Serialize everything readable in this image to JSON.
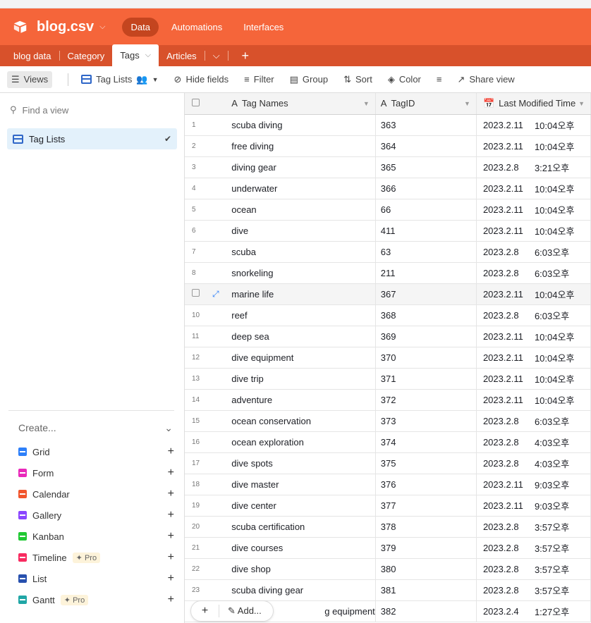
{
  "app": {
    "base_name": "blog.csv",
    "nav": [
      "Data",
      "Automations",
      "Interfaces"
    ]
  },
  "tables": [
    "blog data",
    "Category",
    "Tags",
    "Articles"
  ],
  "toolbar": {
    "views": "Views",
    "current_view": "Tag Lists",
    "hide_fields": "Hide fields",
    "filter": "Filter",
    "group": "Group",
    "sort": "Sort",
    "color": "Color",
    "share_view": "Share view"
  },
  "sidebar": {
    "find_placeholder": "Find a view",
    "views": [
      {
        "label": "Tag Lists"
      }
    ],
    "create_label": "Create...",
    "create_items": [
      {
        "label": "Grid",
        "color": "#2d7ff9"
      },
      {
        "label": "Form",
        "color": "#e929ba"
      },
      {
        "label": "Calendar",
        "color": "#f2552c"
      },
      {
        "label": "Gallery",
        "color": "#8b46ff"
      },
      {
        "label": "Kanban",
        "color": "#20c933"
      },
      {
        "label": "Timeline",
        "color": "#f82b60",
        "badge": "Pro"
      },
      {
        "label": "List",
        "color": "#2750ae"
      },
      {
        "label": "Gantt",
        "color": "#20a6a6",
        "badge": "Pro"
      }
    ]
  },
  "columns": [
    "Tag Names",
    "TagID",
    "Last Modified Time"
  ],
  "rows": [
    {
      "n": "1",
      "name": "scuba diving",
      "id": "363",
      "date": "2023.2.11",
      "time": "10:04오후"
    },
    {
      "n": "2",
      "name": "free diving",
      "id": "364",
      "date": "2023.2.11",
      "time": "10:04오후"
    },
    {
      "n": "3",
      "name": "diving gear",
      "id": "365",
      "date": "2023.2.8",
      "time": "3:21오후"
    },
    {
      "n": "4",
      "name": "underwater",
      "id": "366",
      "date": "2023.2.11",
      "time": "10:04오후"
    },
    {
      "n": "5",
      "name": "ocean",
      "id": "66",
      "date": "2023.2.11",
      "time": "10:04오후"
    },
    {
      "n": "6",
      "name": "dive",
      "id": "411",
      "date": "2023.2.11",
      "time": "10:04오후"
    },
    {
      "n": "7",
      "name": "scuba",
      "id": "63",
      "date": "2023.2.8",
      "time": "6:03오후"
    },
    {
      "n": "8",
      "name": "snorkeling",
      "id": "211",
      "date": "2023.2.8",
      "time": "6:03오후"
    },
    {
      "n": "",
      "name": "marine life",
      "id": "367",
      "date": "2023.2.11",
      "time": "10:04오후",
      "hover": true
    },
    {
      "n": "10",
      "name": "reef",
      "id": "368",
      "date": "2023.2.8",
      "time": "6:03오후"
    },
    {
      "n": "11",
      "name": "deep sea",
      "id": "369",
      "date": "2023.2.11",
      "time": "10:04오후"
    },
    {
      "n": "12",
      "name": "dive equipment",
      "id": "370",
      "date": "2023.2.11",
      "time": "10:04오후"
    },
    {
      "n": "13",
      "name": "dive trip",
      "id": "371",
      "date": "2023.2.11",
      "time": "10:04오후"
    },
    {
      "n": "14",
      "name": "adventure",
      "id": "372",
      "date": "2023.2.11",
      "time": "10:04오후"
    },
    {
      "n": "15",
      "name": "ocean conservation",
      "id": "373",
      "date": "2023.2.8",
      "time": "6:03오후"
    },
    {
      "n": "16",
      "name": "ocean exploration",
      "id": "374",
      "date": "2023.2.8",
      "time": "4:03오후"
    },
    {
      "n": "17",
      "name": "dive spots",
      "id": "375",
      "date": "2023.2.8",
      "time": "4:03오후"
    },
    {
      "n": "18",
      "name": "dive master",
      "id": "376",
      "date": "2023.2.11",
      "time": "9:03오후"
    },
    {
      "n": "19",
      "name": "dive center",
      "id": "377",
      "date": "2023.2.11",
      "time": "9:03오후"
    },
    {
      "n": "20",
      "name": "scuba certification",
      "id": "378",
      "date": "2023.2.8",
      "time": "3:57오후"
    },
    {
      "n": "21",
      "name": "dive courses",
      "id": "379",
      "date": "2023.2.8",
      "time": "3:57오후"
    },
    {
      "n": "22",
      "name": "dive shop",
      "id": "380",
      "date": "2023.2.8",
      "time": "3:57오후"
    },
    {
      "n": "23",
      "name": "scuba diving gear",
      "id": "381",
      "date": "2023.2.8",
      "time": "3:57오후"
    },
    {
      "n": "",
      "name": "g equipment",
      "id": "382",
      "date": "2023.2.4",
      "time": "1:27오후"
    }
  ],
  "add_label": "Add..."
}
